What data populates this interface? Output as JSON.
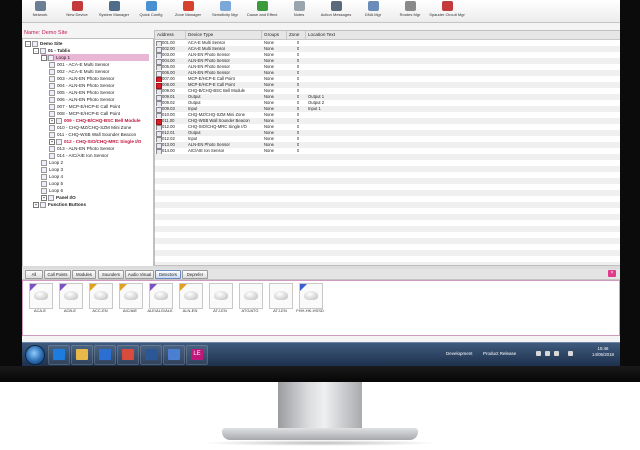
{
  "toolbar": [
    {
      "label": "Network",
      "icon": "network-icon",
      "color": "#6a7f95"
    },
    {
      "label": "New Device",
      "icon": "new-device-icon",
      "color": "#c23a3a"
    },
    {
      "label": "System Manager",
      "icon": "system-manager-icon",
      "color": "#4d6d8a"
    },
    {
      "label": "Quick Config",
      "icon": "quick-config-icon",
      "color": "#4a8fcf"
    },
    {
      "label": "Zone Manager",
      "icon": "zone-manager-icon",
      "color": "#d6422e"
    },
    {
      "label": "Sensitivity Mgr",
      "icon": "sensitivity-icon",
      "color": "#7aa8d8"
    },
    {
      "label": "Cause and Effect",
      "icon": "cause-effect-icon",
      "color": "#3c9a3c"
    },
    {
      "label": "Notes",
      "icon": "notes-icon",
      "color": "#9aa4ae"
    },
    {
      "label": "Action Messages",
      "icon": "action-messages-icon",
      "color": "#5a6a7a"
    },
    {
      "label": "DNA Mgr",
      "icon": "dna-icon",
      "color": "#6b8bb8"
    },
    {
      "label": "Routes Mgr",
      "icon": "routes-icon",
      "color": "#8a8a8a"
    },
    {
      "label": "Spauder Circuit Mgr",
      "icon": "circuit-icon",
      "color": "#c23a3a"
    }
  ],
  "site_name": "Name: Demo Site",
  "tree": [
    {
      "label": "Demo Site",
      "indent": 0,
      "exp": "-",
      "style": "bold"
    },
    {
      "label": "01 - Tablis",
      "indent": 1,
      "exp": "-",
      "style": "bold"
    },
    {
      "label": "Loop 1",
      "indent": 2,
      "exp": "-",
      "style": "sel"
    },
    {
      "label": "001 - ACA-E Multi Sensor",
      "indent": 3,
      "exp": "",
      "style": ""
    },
    {
      "label": "002 - ACA-E Multi Sensor",
      "indent": 3,
      "exp": "",
      "style": ""
    },
    {
      "label": "003 - ALN-EN Photo Sensor",
      "indent": 3,
      "exp": "",
      "style": ""
    },
    {
      "label": "004 - ALN-EN Photo Sensor",
      "indent": 3,
      "exp": "",
      "style": ""
    },
    {
      "label": "005 - ALN-EN Photo Sensor",
      "indent": 3,
      "exp": "",
      "style": ""
    },
    {
      "label": "006 - ALN-EN Photo Sensor",
      "indent": 3,
      "exp": "",
      "style": ""
    },
    {
      "label": "007 - MCP-E/HCP-E Call Point",
      "indent": 3,
      "exp": "",
      "style": ""
    },
    {
      "label": "008 - MCP-E/HCP-E Call Point",
      "indent": 3,
      "exp": "",
      "style": ""
    },
    {
      "label": "009 - CHQ-B/CHQ-BSC Bell Module",
      "indent": 3,
      "exp": "+",
      "style": "red"
    },
    {
      "label": "010 - CHQ-MZ/CHQ-SZM Mini Zone",
      "indent": 3,
      "exp": "",
      "style": ""
    },
    {
      "label": "011 - CHQ-WSB Wall Sounder Beacon",
      "indent": 3,
      "exp": "",
      "style": ""
    },
    {
      "label": "012 - CHQ-SIO/CHQ-MRC Single I/O",
      "indent": 3,
      "exp": "+",
      "style": "red"
    },
    {
      "label": "013 - ALN-EN Photo Sensor",
      "indent": 3,
      "exp": "",
      "style": ""
    },
    {
      "label": "014 - AIC/AIE Ion Sensor",
      "indent": 3,
      "exp": "",
      "style": ""
    },
    {
      "label": "Loop 2",
      "indent": 2,
      "exp": "",
      "style": ""
    },
    {
      "label": "Loop 3",
      "indent": 2,
      "exp": "",
      "style": ""
    },
    {
      "label": "Loop 4",
      "indent": 2,
      "exp": "",
      "style": ""
    },
    {
      "label": "Loop 5",
      "indent": 2,
      "exp": "",
      "style": ""
    },
    {
      "label": "Loop 6",
      "indent": 2,
      "exp": "",
      "style": ""
    },
    {
      "label": "Panel I/O",
      "indent": 2,
      "exp": "+",
      "style": "bold"
    },
    {
      "label": "Function Buttons",
      "indent": 1,
      "exp": "+",
      "style": "bold"
    }
  ],
  "table": {
    "headers": [
      "Address",
      "Device Type",
      "Groups",
      "Zone",
      "Location Text"
    ],
    "rows": [
      [
        "001.00",
        "ACA-E Multi Sensor",
        "None",
        "0",
        "",
        ""
      ],
      [
        "002.00",
        "ACA-E Multi Sensor",
        "None",
        "0",
        "",
        ""
      ],
      [
        "003.00",
        "ALN-EN Photo Sensor",
        "None",
        "0",
        "",
        ""
      ],
      [
        "004.00",
        "ALN-EN Photo Sensor",
        "None",
        "0",
        "",
        ""
      ],
      [
        "005.00",
        "ALN-EN Photo Sensor",
        "None",
        "0",
        "",
        ""
      ],
      [
        "006.00",
        "ALN-EN Photo Sensor",
        "None",
        "0",
        "",
        ""
      ],
      [
        "007.00",
        "MCP-E/HCP-E Call Point",
        "None",
        "0",
        "",
        "red"
      ],
      [
        "008.00",
        "MCP-E/HCP-E Call Point",
        "None",
        "0",
        "",
        "red"
      ],
      [
        "009.00",
        "CHQ-B/CHQ-BSC Bell Module",
        "None",
        "0",
        "",
        ""
      ],
      [
        "009.01",
        "Output",
        "None",
        "0",
        "Output 1",
        ""
      ],
      [
        "009.02",
        "Output",
        "None",
        "0",
        "Output 2",
        ""
      ],
      [
        "009.03",
        "Input",
        "None",
        "0",
        "Input 1",
        ""
      ],
      [
        "010.00",
        "CHQ-MZ/CHQ-SZM Mini Zone",
        "None",
        "0",
        "",
        ""
      ],
      [
        "011.00",
        "CHQ-WSB Wall Sounder Beacon",
        "None",
        "0",
        "",
        "red"
      ],
      [
        "012.00",
        "CHQ-SIO/CHQ-MRC Single I/O",
        "None",
        "0",
        "",
        ""
      ],
      [
        "012.01",
        "Output",
        "None",
        "0",
        "",
        ""
      ],
      [
        "012.02",
        "Input",
        "None",
        "0",
        "",
        ""
      ],
      [
        "013.00",
        "ALN-EN Photo Sensor",
        "None",
        "0",
        "",
        ""
      ],
      [
        "014.00",
        "AIC/AIE Ion Sensor",
        "None",
        "0",
        "",
        ""
      ]
    ]
  },
  "filters": [
    {
      "label": "All",
      "active": false
    },
    {
      "label": "Call Points",
      "active": false
    },
    {
      "label": "Modules",
      "active": false
    },
    {
      "label": "Sounders",
      "active": false
    },
    {
      "label": "Audio Visual",
      "active": false
    },
    {
      "label": "Detectors",
      "active": true
    },
    {
      "label": "Deprefer",
      "active": false
    }
  ],
  "filter_close": "×",
  "palette": [
    {
      "label": "ACA-E",
      "mark": "#7b52c4"
    },
    {
      "label": "ACB-E",
      "mark": "#7b52c4"
    },
    {
      "label": "ACC-EN",
      "mark": "#e0a020"
    },
    {
      "label": "AIC/AIE",
      "mark": "#e0a020"
    },
    {
      "label": "ALE/ALG/ALK",
      "mark": "#7b52c4"
    },
    {
      "label": "ALN-EN",
      "mark": "#e0a020"
    },
    {
      "label": "ATJ-EN",
      "mark": ""
    },
    {
      "label": "ATG/ATG",
      "mark": ""
    },
    {
      "label": "ATJ-EN",
      "mark": ""
    },
    {
      "label": "FHH-HK-HSSD",
      "mark": "#3b5fd0"
    }
  ],
  "taskbar": {
    "apps": [
      {
        "name": "ie-icon",
        "color": "#1e7be0"
      },
      {
        "name": "explorer-icon",
        "color": "#e8b84a"
      },
      {
        "name": "doc-icon",
        "color": "#2a6fd1"
      },
      {
        "name": "chrome-icon",
        "color": "#d94b3c"
      },
      {
        "name": "word-icon",
        "color": "#2b5797"
      },
      {
        "name": "mail-icon",
        "color": "#4a7fd1"
      },
      {
        "name": "le-app-icon",
        "color": "#c0187a"
      }
    ],
    "le_label": "LE",
    "tray_development": "Development",
    "tray_product": "Product Release",
    "clock_time": "15:46",
    "clock_date": "14/05/2018"
  }
}
